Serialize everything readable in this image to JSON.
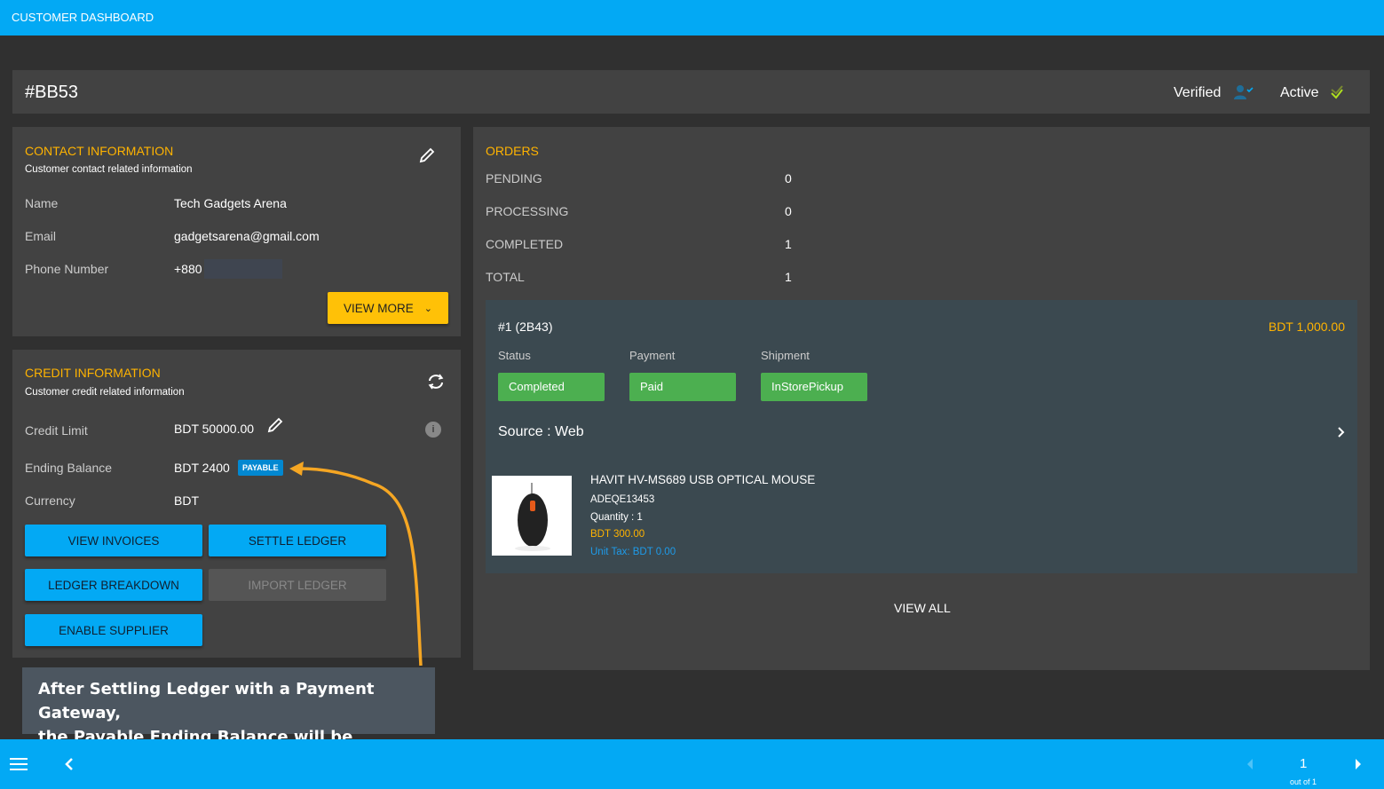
{
  "app": {
    "title": "CUSTOMER DASHBOARD"
  },
  "header": {
    "customer_id": "#BB53",
    "verified": "Verified",
    "active": "Active"
  },
  "contact": {
    "title": "CONTACT INFORMATION",
    "subtitle": "Customer contact related information",
    "fields": [
      {
        "label": "Name",
        "value": "Tech Gadgets Arena"
      },
      {
        "label": "Email",
        "value": "gadgetsarena@gmail.com"
      },
      {
        "label": "Phone Number",
        "value": "+880"
      }
    ],
    "view_more": "VIEW MORE"
  },
  "credit": {
    "title": "CREDIT INFORMATION",
    "subtitle": "Customer credit related information",
    "credit_limit_label": "Credit Limit",
    "credit_limit": "BDT 50000.00",
    "ending_balance_label": "Ending Balance",
    "ending_balance": "BDT 2400",
    "badge": "PAYABLE",
    "currency_label": "Currency",
    "currency": "BDT",
    "buttons": {
      "view_invoices": "VIEW INVOICES",
      "settle_ledger": "SETTLE LEDGER",
      "ledger_breakdown": "LEDGER BREAKDOWN",
      "import_ledger": "IMPORT LEDGER",
      "enable_supplier": "ENABLE SUPPLIER"
    }
  },
  "orders": {
    "title": "ORDERS",
    "stats": [
      {
        "label": "PENDING",
        "value": "0"
      },
      {
        "label": "PROCESSING",
        "value": "0"
      },
      {
        "label": "COMPLETED",
        "value": "1"
      },
      {
        "label": "TOTAL",
        "value": "1"
      }
    ],
    "order": {
      "id": "#1 (2B43)",
      "amount": "BDT 1,000.00",
      "status_label": "Status",
      "status": "Completed",
      "payment_label": "Payment",
      "payment": "Paid",
      "shipment_label": "Shipment",
      "shipment": "InStorePickup",
      "source": "Source : Web",
      "item": {
        "name": "HAVIT HV-MS689 USB OPTICAL MOUSE",
        "sku": "ADEQE13453",
        "quantity": "Quantity : 1",
        "price": "BDT 300.00",
        "tax": "Unit Tax: BDT 0.00"
      }
    },
    "view_all": "VIEW ALL"
  },
  "annotation": {
    "line1": "After Settling Ledger with a Payment Gateway,",
    "line2": "the Payable Ending Balance will be updated"
  },
  "pagination": {
    "page": "1",
    "total": "out of 1"
  },
  "colors": {
    "primary": "#03a9f4",
    "accent": "#ffb300",
    "success": "#4caf50",
    "annotation_arrow": "#f5a623"
  }
}
